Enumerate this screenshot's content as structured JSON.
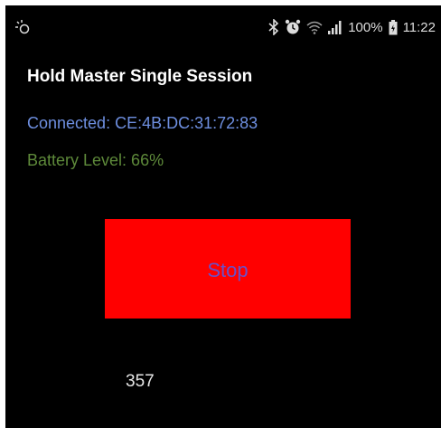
{
  "status_bar": {
    "left_icon": "ir-sensor-icon",
    "icons": [
      "bluetooth-icon",
      "alarm-icon",
      "wifi-icon",
      "signal-icon",
      "battery-icon"
    ],
    "battery_percent": "100%",
    "time": "11:22"
  },
  "app": {
    "title": "Hold Master Single Session",
    "connected_text": "Connected: CE:4B:DC:31:72:83",
    "battery_level_text": "Battery Level: 66%",
    "stop_label": "Stop",
    "counter": "357"
  },
  "colors": {
    "background": "#000000",
    "connected": "#6e8fe0",
    "battery": "#5e8a3a",
    "stop_button": "#ff0000",
    "stop_text": "#6a4fc8"
  }
}
